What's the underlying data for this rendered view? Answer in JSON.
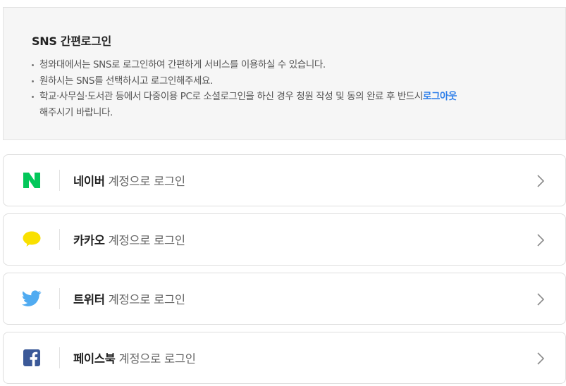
{
  "info": {
    "title": "SNS 간편로그인",
    "notices": [
      "청와대에서는 SNS로 로그인하여 간편하게 서비스를 이용하실 수 있습니다.",
      "원하시는 SNS를 선택하시고 로그인해주세요."
    ],
    "notice3_line1": "학교·사무실·도서관 등에서 다중이용 PC로 소셜로그인을 하신 경우 청원 작성 및 동의 완료 후 반드시",
    "notice3_link": "로그아웃",
    "notice3_line2": "해주시기 바랍니다."
  },
  "logins": [
    {
      "brand": "네이버",
      "suffix": "계정으로 로그인",
      "icon": "naver-icon",
      "color": "#03c75a"
    },
    {
      "brand": "카카오",
      "suffix": "계정으로 로그인",
      "icon": "kakao-icon",
      "color": "#f9e000"
    },
    {
      "brand": "트위터",
      "suffix": "계정으로 로그인",
      "icon": "twitter-icon",
      "color": "#50abf1"
    },
    {
      "brand": "페이스북",
      "suffix": "계정으로 로그인",
      "icon": "facebook-icon",
      "color": "#3b5998"
    }
  ]
}
